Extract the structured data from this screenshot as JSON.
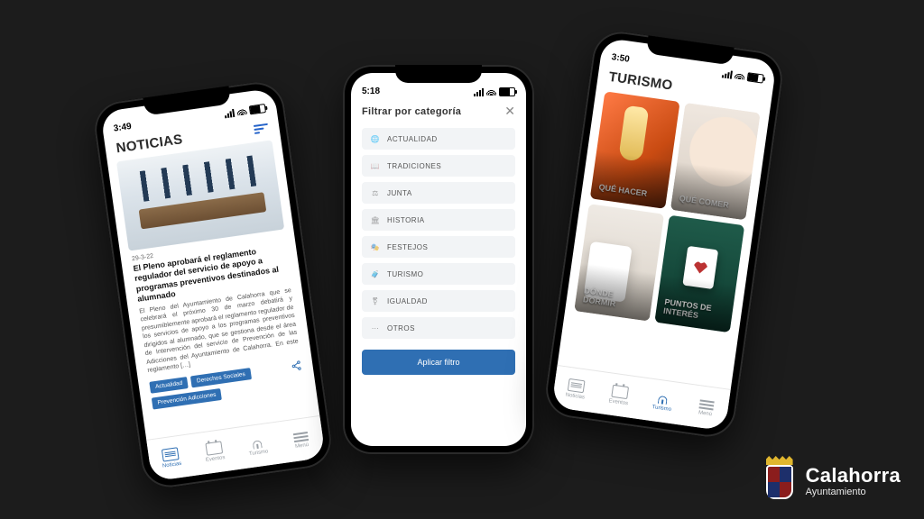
{
  "status_times": {
    "p1": "3:49",
    "p2": "5:18",
    "p3": "3:50"
  },
  "noticias": {
    "header": "NOTICIAS",
    "date": "29-3-22",
    "title": "El Pleno aprobará el reglamento regulador del servicio de apoyo a programas preventivos destinados al alumnado",
    "body": "El Pleno del Ayuntamiento de Calahorra que se celebrará el próximo 30 de marzo debatirá y presumiblemente aprobará el reglamento regulador de los servicios de apoyo a los programas preventivos dirigidos al alumnado, que se gestiona desde el área de Intervención del servicio de Prevención de las Adicciones del Ayuntamiento de Calahorra. En este reglamento […]",
    "chips": [
      "Actualidad",
      "Derechos Sociales",
      "Prevención Adicciones"
    ]
  },
  "filter": {
    "header": "Filtrar por categoría",
    "items": [
      {
        "icon": "globe-icon",
        "label": "ACTUALIDAD"
      },
      {
        "icon": "book-icon",
        "label": "TRADICIONES"
      },
      {
        "icon": "gavel-icon",
        "label": "JUNTA"
      },
      {
        "icon": "bank-icon",
        "label": "HISTORIA"
      },
      {
        "icon": "mask-icon",
        "label": "FESTEJOS"
      },
      {
        "icon": "suitcase-icon",
        "label": "TURISMO"
      },
      {
        "icon": "balance-icon",
        "label": "IGUALDAD"
      },
      {
        "icon": "dots-icon",
        "label": "OTROS"
      }
    ],
    "apply": "Aplicar filtro"
  },
  "turismo": {
    "header": "TURISMO",
    "cards": [
      {
        "label": "QUÉ HACER"
      },
      {
        "label": "QUÉ COMER"
      },
      {
        "label": "DÓNDE DORMIR"
      },
      {
        "label": "PUNTOS DE INTERÉS"
      }
    ]
  },
  "tabs": {
    "noticias": "Noticias",
    "eventos": "Eventos",
    "turismo": "Turismo",
    "menu": "Menú"
  },
  "brand": {
    "city": "Calahorra",
    "sub": "Ayuntamiento"
  },
  "icons": {
    "globe-icon": "🌐",
    "book-icon": "📖",
    "gavel-icon": "⚖",
    "bank-icon": "🏛",
    "mask-icon": "🎭",
    "suitcase-icon": "🧳",
    "balance-icon": "⚧",
    "dots-icon": "⋯"
  }
}
